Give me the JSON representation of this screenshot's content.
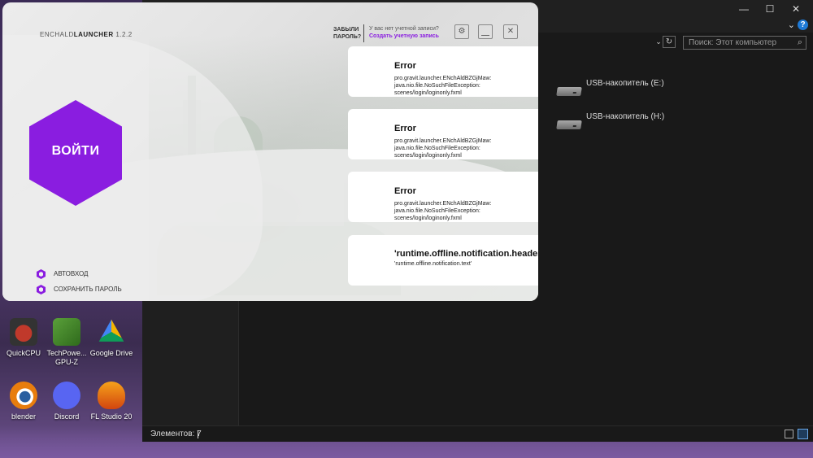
{
  "launcher": {
    "brand": "ENCHALD",
    "name": "LAUNCHER",
    "version": "1.2.2",
    "forgot_password": [
      "ЗАБЫЛИ",
      "ПАРОЛЬ?"
    ],
    "no_account": "У вас нет учетной записи?",
    "create_account": "Создать учетную запись",
    "login_button": "ВОЙТИ",
    "options": [
      "АВТОВХОД",
      "СОХРАНИТЬ ПАРОЛЬ"
    ],
    "accent_color": "#8a1de0",
    "buttons": [
      {
        "name": "settings-icon",
        "glyph": "⚙"
      },
      {
        "name": "minimize-icon",
        "glyph": "_"
      },
      {
        "name": "close-icon",
        "glyph": "✕"
      }
    ],
    "notifications": [
      {
        "title": "Error",
        "text": "pro.gravit.launcher.ENchAldBZGjMaw: java.nio.file.NoSuchFileException: scenes/login/loginonly.fxml"
      },
      {
        "title": "Error",
        "text": "pro.gravit.launcher.ENchAldBZGjMaw: java.nio.file.NoSuchFileException: scenes/login/loginonly.fxml"
      },
      {
        "title": "Error",
        "text": "pro.gravit.launcher.ENchAldBZGjMaw: java.nio.file.NoSuchFileException: scenes/login/loginonly.fxml"
      },
      {
        "title": "'runtime.offline.notification.header'",
        "text": "'runtime.offline.notification.text'"
      }
    ]
  },
  "explorer": {
    "search_placeholder": "Поиск: Этот компьютер",
    "drives": [
      "USB-накопитель (E:)",
      "USB-накопитель (H:)"
    ],
    "status": "Элементов: 7",
    "window_controls": [
      "—",
      "☐",
      "✕"
    ]
  },
  "desktop": {
    "icons": [
      {
        "label": "QuickCPU",
        "color": "#c0392b"
      },
      {
        "label": "TechPowe... GPU-Z",
        "color": "#4a8a2a"
      },
      {
        "label": "Google Drive",
        "color": "#1e9e5a"
      },
      {
        "label": "blender",
        "color": "#e87d0d"
      },
      {
        "label": "Discord",
        "color": "#5865f2"
      },
      {
        "label": "FL Studio 20",
        "color": "#e46b1b"
      }
    ]
  }
}
